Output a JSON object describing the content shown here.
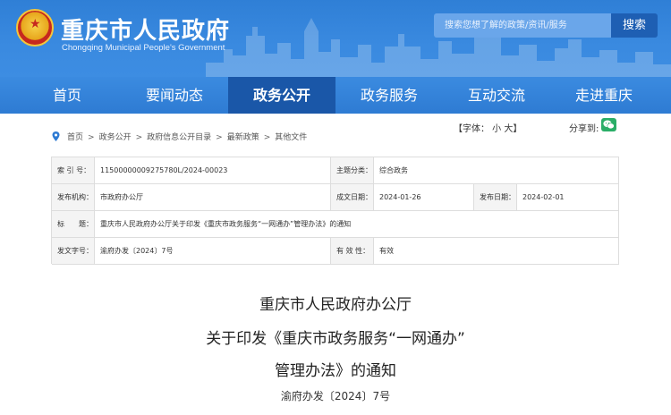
{
  "header": {
    "title": "重庆市人民政府",
    "subtitle": "Chongqing Municipal People's Government",
    "search_placeholder": "搜索您想了解的政策/资讯/服务",
    "search_button": "搜索",
    "emblem_icon": "national-emblem-icon"
  },
  "nav": {
    "items": [
      {
        "label": "首页"
      },
      {
        "label": "要闻动态"
      },
      {
        "label": "政务公开"
      },
      {
        "label": "政务服务"
      },
      {
        "label": "互动交流"
      },
      {
        "label": "走进重庆"
      }
    ],
    "active_index": 2
  },
  "breadcrumb": {
    "items": [
      "首页",
      "政务公开",
      "政府信息公开目录",
      "最新政策",
      "其他文件"
    ],
    "separator": ">"
  },
  "tools": {
    "font_label": "【字体： 小 大】",
    "share_label": "分享到:"
  },
  "meta": {
    "index_label": "索 引 号：",
    "index_value": "11500000009275780L/2024-00023",
    "category_label": "主题分类：",
    "category_value": "综合政务",
    "issuer_label": "发布机构：",
    "issuer_value": "市政府办公厅",
    "created_label": "成文日期：",
    "created_value": "2024-01-26",
    "published_label": "发布日期：",
    "published_value": "2024-02-01",
    "title_label": "标　　题：",
    "title_value": "重庆市人民政府办公厅关于印发《重庆市政务服务“一网通办”管理办法》的通知",
    "docno_label": "发文字号：",
    "docno_value": "渝府办发〔2024〕7号",
    "validity_label": "有 效 性：",
    "validity_value": "有效"
  },
  "document": {
    "line1": "重庆市人民政府办公厅",
    "line2": "关于印发《重庆市政务服务“一网通办”",
    "line3": "管理办法》的通知",
    "number": "渝府办发〔2024〕7号"
  },
  "colors": {
    "header_blue": "#3a8ae0",
    "nav_active": "#1a57a8",
    "search_button": "#1e5fb3",
    "wechat_green": "#2aae67"
  }
}
